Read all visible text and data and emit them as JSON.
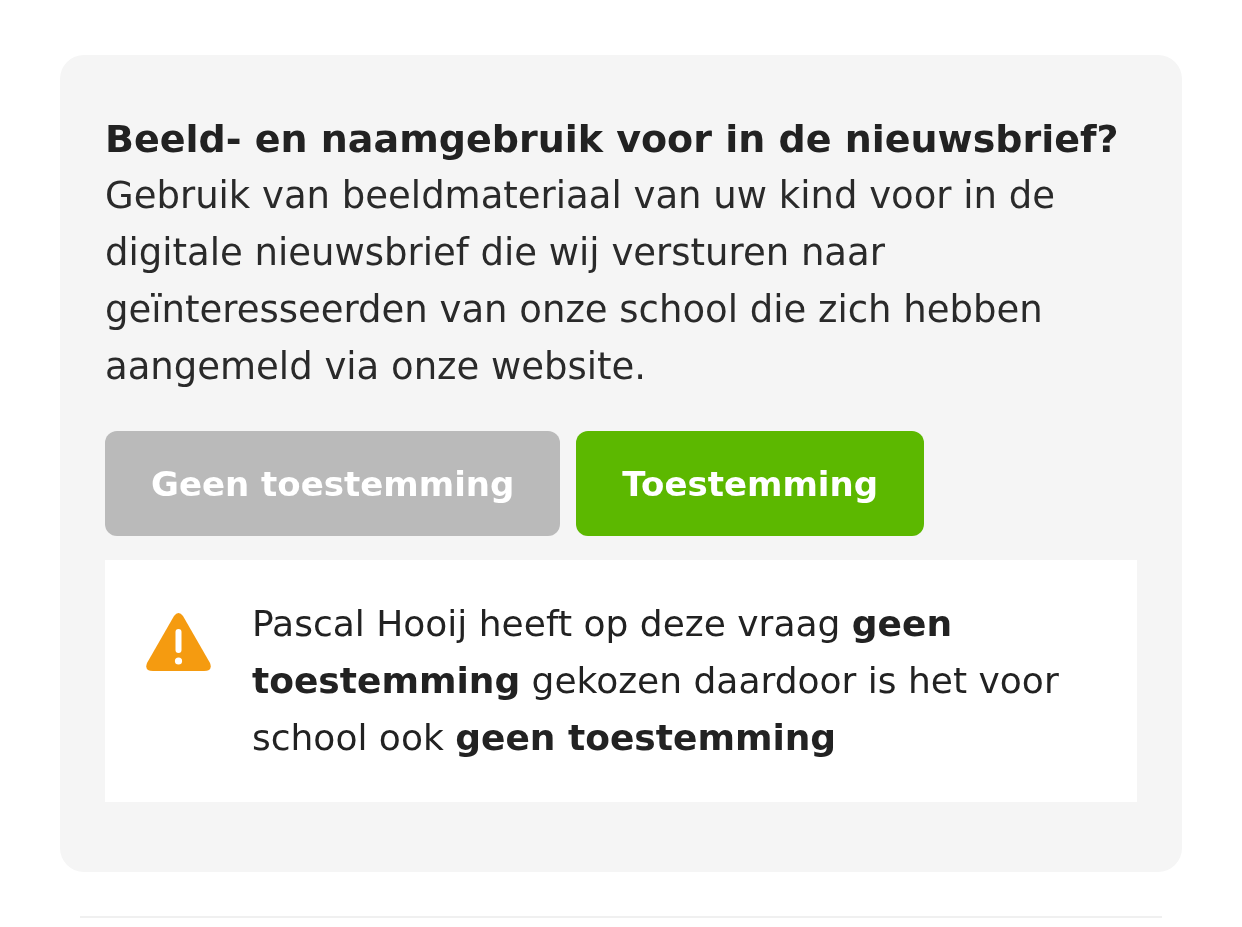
{
  "card": {
    "title": "Beeld- en naamgebruik voor in de nieuwsbrief?",
    "description": "Gebruik van beeldmateriaal van uw kind voor in de digitale nieuwsbrief die wij versturen naar geïnteresseerden van onze school die zich hebben aangemeld via onze website.",
    "buttons": [
      {
        "label": "Geen toestemming",
        "selected": false
      },
      {
        "label": "Toestemming",
        "selected": true
      }
    ],
    "notice": {
      "kind": "warning",
      "text": "Pascal Hooij heeft op deze vraag **geen toestemming** gekozen daardoor is het voor school ook **geen toestemming**"
    }
  }
}
